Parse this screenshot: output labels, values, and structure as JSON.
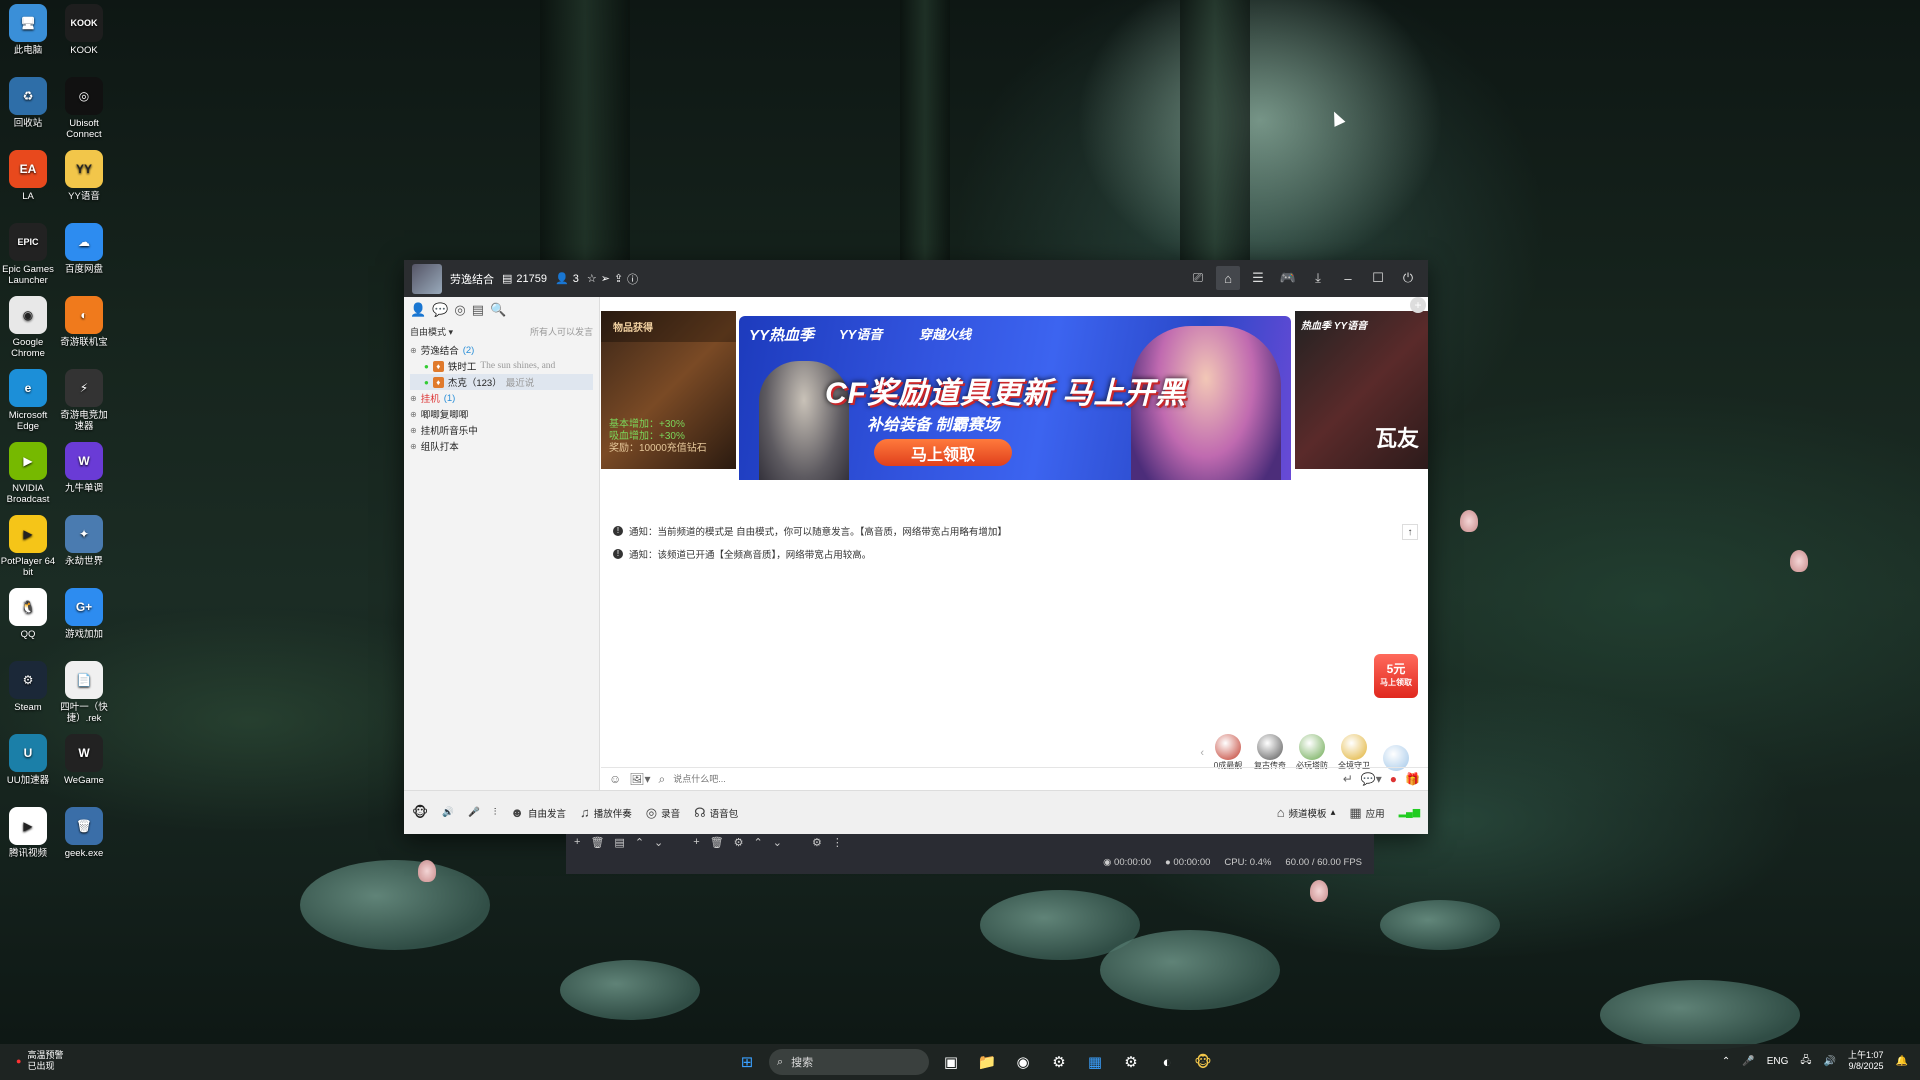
{
  "desktop_icons": [
    {
      "label": "此电脑",
      "icon": "computer-icon",
      "color": "#3a8fd8",
      "glyph": "🖥"
    },
    {
      "label": "KOOK",
      "icon": "kook-icon",
      "color": "#1e1e1e",
      "glyph": "KOOK"
    },
    {
      "label": "回收站",
      "icon": "recycle-bin-icon",
      "color": "#2e6ea8",
      "glyph": "♻"
    },
    {
      "label": "Ubisoft Connect",
      "icon": "ubisoft-icon",
      "color": "#111",
      "glyph": "◎"
    },
    {
      "label": "LA",
      "icon": "ea-icon",
      "color": "#e8491d",
      "glyph": "EA"
    },
    {
      "label": "YY语音",
      "icon": "yy-icon",
      "color": "#f2c64a",
      "glyph": "YY"
    },
    {
      "label": "Epic Games Launcher",
      "icon": "epic-icon",
      "color": "#222",
      "glyph": "EPIC"
    },
    {
      "label": "百度网盘",
      "icon": "baidu-netdisk-icon",
      "color": "#2d8cf0",
      "glyph": "☁"
    },
    {
      "label": "Google Chrome",
      "icon": "chrome-icon",
      "color": "#e8e8e8",
      "glyph": "◉"
    },
    {
      "label": "奇游联机宝",
      "icon": "qiyou-icon",
      "color": "#f07a1c",
      "glyph": "◐"
    },
    {
      "label": "Microsoft Edge",
      "icon": "edge-icon",
      "color": "#1c8fd8",
      "glyph": "e"
    },
    {
      "label": "奇游电竞加速器",
      "icon": "qiyou-accel-icon",
      "color": "#333",
      "glyph": "⚡"
    },
    {
      "label": "NVIDIA Broadcast",
      "icon": "nvidia-icon",
      "color": "#76b900",
      "glyph": "▶"
    },
    {
      "label": "九牛单调",
      "icon": "w-app-icon",
      "color": "#6a3bd6",
      "glyph": "W"
    },
    {
      "label": "PotPlayer 64 bit",
      "icon": "potplayer-icon",
      "color": "#f5c518",
      "glyph": "▶"
    },
    {
      "label": "永劫世界",
      "icon": "game-icon",
      "color": "#4a7bb0",
      "glyph": "✦"
    },
    {
      "label": "QQ",
      "icon": "qq-icon",
      "color": "#fff",
      "glyph": "🐧"
    },
    {
      "label": "游戏加加",
      "icon": "gameplus-icon",
      "color": "#2d8cf0",
      "glyph": "G+"
    },
    {
      "label": "Steam",
      "icon": "steam-icon",
      "color": "#1b2838",
      "glyph": "⚙"
    },
    {
      "label": "四叶一（快捷）.rek",
      "icon": "file-icon",
      "color": "#f0f0f0",
      "glyph": "📄"
    },
    {
      "label": "UU加速器",
      "icon": "uu-icon",
      "color": "#1b7fa8",
      "glyph": "U"
    },
    {
      "label": "WeGame",
      "icon": "wegame-icon",
      "color": "#222",
      "glyph": "W"
    },
    {
      "label": "腾讯视频",
      "icon": "tencent-video-icon",
      "color": "#fff",
      "glyph": "▶"
    },
    {
      "label": "geek.exe",
      "icon": "geek-icon",
      "color": "#3a6ea8",
      "glyph": "🗑"
    }
  ],
  "window": {
    "channel_name": "劳逸结合",
    "channel_id": "21759",
    "online_count": "3",
    "title_icons": [
      "star-icon",
      "forward-icon",
      "share-icon",
      "info-icon"
    ],
    "right_buttons": [
      "screen-icon",
      "home-icon",
      "list-icon",
      "gamepad-icon",
      "download-icon",
      "minimize-icon",
      "maximize-icon",
      "close-icon"
    ]
  },
  "sidebar": {
    "mode": "自由模式",
    "speak_perm": "所有人可以发言",
    "tree": [
      {
        "label": "劳逸结合",
        "count": "(2)",
        "level": 0,
        "selected": false
      },
      {
        "label": "铁时工",
        "extra": "The sun shines, and",
        "level": 1,
        "selected": false
      },
      {
        "label": "杰克（123）",
        "extra": "最近说",
        "level": 1,
        "selected": true
      },
      {
        "label": "挂机",
        "count": "(1)",
        "level": 0,
        "selected": false,
        "red": true
      },
      {
        "label": "唧唧复唧唧",
        "level": 0,
        "selected": false
      },
      {
        "label": "挂机听音乐中",
        "level": 0,
        "selected": false
      },
      {
        "label": "组队打本",
        "level": 0,
        "selected": false
      }
    ]
  },
  "banner": {
    "left_card": {
      "title": "物品获得",
      "lines": [
        "基本增加：+30%",
        "吸血增加：+30%",
        "奖励：10000充值钻石"
      ]
    },
    "tags": [
      "YY热血季",
      "YY语音",
      "穿越火线"
    ],
    "headline": "CF奖励道具更新 马上开黑",
    "subline": "补给装备 制霸赛场",
    "cta": "马上领取",
    "right_card": {
      "title": "热血季",
      "tag": "YY语音",
      "text": "瓦友"
    }
  },
  "messages": [
    "通知：当前频道的模式是 自由模式，你可以随意发言。【高音质，网络带宽占用略有增加】",
    "通知：该频道已开通【全频高音质】，网络带宽占用较高。"
  ],
  "red_packet": {
    "amount": "5元",
    "label": "马上领取"
  },
  "gifts": [
    {
      "label": "0成最靓",
      "color": "#c0392b"
    },
    {
      "label": "复古传奇",
      "color": "#555"
    },
    {
      "label": "必玩塔防",
      "color": "#6aa84f"
    },
    {
      "label": "全境守卫",
      "color": "#e0b030"
    },
    {
      "label": "",
      "color": "#9fc5e8"
    }
  ],
  "input": {
    "placeholder": "说点什么吧..."
  },
  "bottom_bar": [
    {
      "label": "自由发言",
      "icon": "mic-mode-icon"
    },
    {
      "label": "播放伴奏",
      "icon": "music-icon"
    },
    {
      "label": "录音",
      "icon": "record-icon"
    },
    {
      "label": "语音包",
      "icon": "voice-pack-icon"
    }
  ],
  "bottom_right": [
    {
      "label": "频道模板",
      "icon": "template-icon"
    },
    {
      "label": "应用",
      "icon": "apps-icon"
    }
  ],
  "obs": {
    "time1": "00:00:00",
    "time2": "00:00:00",
    "cpu": "CPU: 0.4%",
    "fps": "60.00 / 60.00 FPS"
  },
  "taskbar": {
    "weather_line1": "高温预警",
    "weather_line2": "已出现",
    "search_placeholder": "搜索",
    "lang": "ENG",
    "time": "上午1:07",
    "date": "9/8/2025"
  }
}
